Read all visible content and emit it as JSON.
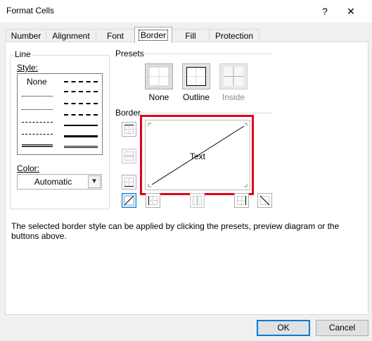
{
  "window": {
    "title": "Format Cells",
    "help_glyph": "?",
    "close_glyph": "✕"
  },
  "tabs": [
    {
      "label": "Number"
    },
    {
      "label": "Alignment"
    },
    {
      "label": "Font"
    },
    {
      "label": "Border",
      "active": true
    },
    {
      "label": "Fill"
    },
    {
      "label": "Protection"
    }
  ],
  "line_group": {
    "title": "Line",
    "style_label": "Style:",
    "style_none": "None",
    "color_label": "Color:",
    "color_value": "Automatic"
  },
  "presets": {
    "title": "Presets",
    "items": [
      {
        "label": "None",
        "icon": "preset-none-icon"
      },
      {
        "label": "Outline",
        "icon": "preset-outline-icon"
      },
      {
        "label": "Inside",
        "icon": "preset-inside-icon",
        "disabled": true
      }
    ]
  },
  "border": {
    "title": "Border",
    "preview_text": "Text"
  },
  "help_text": "The selected border style can be applied by clicking the presets, preview diagram or the buttons above.",
  "footer": {
    "ok": "OK",
    "cancel": "Cancel"
  },
  "colors": {
    "highlight": "#e0001b",
    "accent": "#0078d7"
  }
}
